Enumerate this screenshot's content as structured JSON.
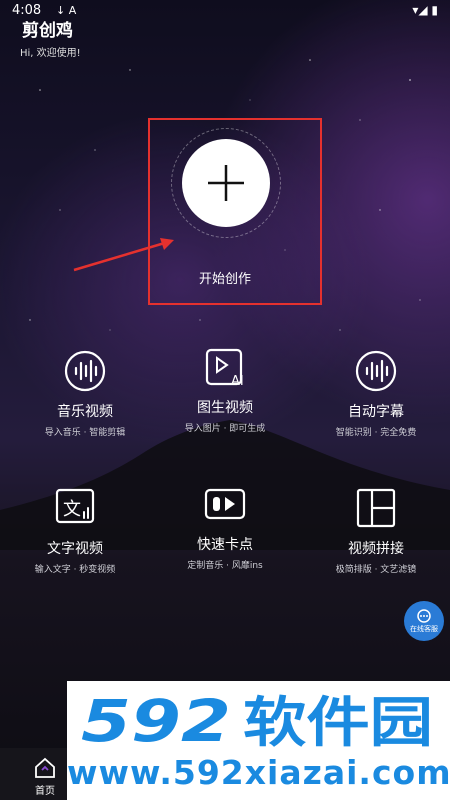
{
  "status_bar": {
    "time": "4:08",
    "left_icons": "↓ A",
    "right_icons": "▾◢ ▮"
  },
  "app": {
    "title": "剪创鸡",
    "subtitle": "Hi, 欢迎使用!"
  },
  "start": {
    "label": "开始创作"
  },
  "features": [
    {
      "title": "音乐视频",
      "subtitle": "导入音乐 · 智能剪辑",
      "icon": "music-wave-icon"
    },
    {
      "title": "图生视频",
      "subtitle": "导入图片 · 即可生成",
      "icon": "ai-video-icon"
    },
    {
      "title": "自动字幕",
      "subtitle": "智能识别 · 完全免费",
      "icon": "subtitle-wave-icon"
    },
    {
      "title": "文字视频",
      "subtitle": "输入文字 · 秒变视频",
      "icon": "text-video-icon"
    },
    {
      "title": "快速卡点",
      "subtitle": "定制音乐 · 风靡ins",
      "icon": "beat-icon"
    },
    {
      "title": "视频拼接",
      "subtitle": "极简排版 · 文艺滤镜",
      "icon": "grid-layout-icon"
    }
  ],
  "customer_service": {
    "label": "在线客服"
  },
  "nav": {
    "home_label": "首页"
  },
  "watermark": {
    "logo_text": "592软件园",
    "url": "www.592xiazai.com"
  },
  "colors": {
    "highlight": "#e5312e",
    "watermark_blue": "#1a8ae0",
    "cs_blue": "#2a7bd6"
  }
}
